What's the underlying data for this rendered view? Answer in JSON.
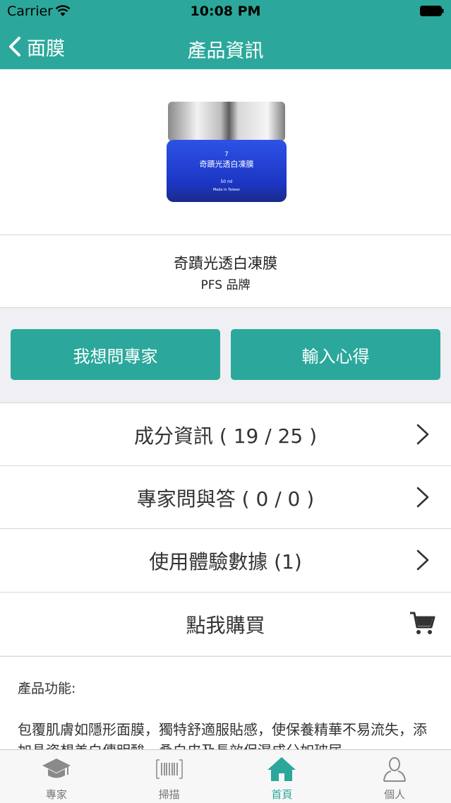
{
  "status_bar": {
    "carrier": "Carrier",
    "time": "10:08 PM"
  },
  "nav": {
    "back_label": "面膜",
    "title": "產品資訊"
  },
  "product": {
    "jar_number": "7",
    "jar_name": "奇蹟光透白凍膜",
    "jar_volume": "50 ml",
    "jar_origin": "Made in Taiwan",
    "name": "奇蹟光透白凍膜",
    "brand": "PFS 品牌"
  },
  "actions": {
    "ask_expert": "我想問專家",
    "enter_review": "輸入心得"
  },
  "rows": [
    {
      "label": "成分資訊 ( 19 / 25 )"
    },
    {
      "label": "專家問與答 ( 0 / 0 )"
    },
    {
      "label": "使用體驗數據 (1)"
    },
    {
      "label": "點我購買"
    }
  ],
  "description": {
    "label": "產品功能:",
    "text": "包覆肌膚如隱形面膜，獨特舒適服貼感，使保養精華不易流失，添加晶瓷想美白傳明酸、桑白皮及長效保濕成分如玻尿"
  },
  "tabs": [
    {
      "label": "專家",
      "icon": "graduation-cap-icon"
    },
    {
      "label": "掃描",
      "icon": "barcode-icon"
    },
    {
      "label": "首頁",
      "icon": "home-icon"
    },
    {
      "label": "個人",
      "icon": "person-icon"
    }
  ],
  "colors": {
    "accent": "#2ba89b",
    "jar_blue": "#1f3fd0"
  }
}
